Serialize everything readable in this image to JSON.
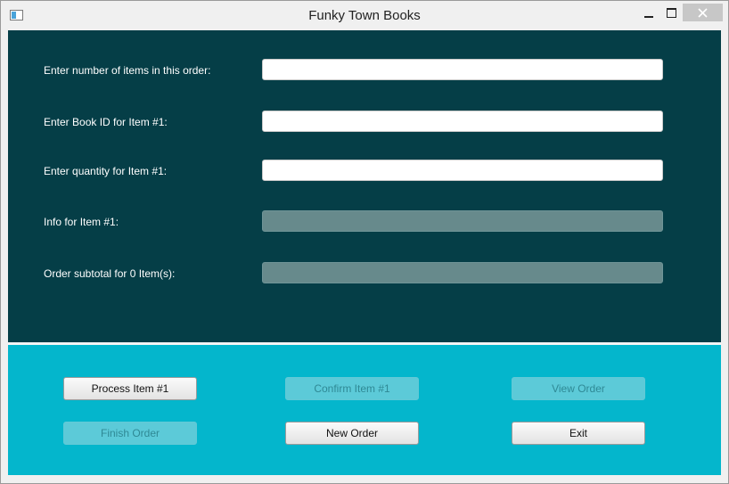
{
  "window": {
    "title": "Funky Town Books",
    "icons": [
      "app-icon",
      "minimize-icon",
      "maximize-icon",
      "close-icon"
    ]
  },
  "form": {
    "rows": [
      {
        "label": "Enter number of items in this order:",
        "value": "",
        "enabled": true
      },
      {
        "label": "Enter Book ID for Item #1:",
        "value": "",
        "enabled": true
      },
      {
        "label": "Enter quantity for Item #1:",
        "value": "",
        "enabled": true
      },
      {
        "label": "Info for Item #1:",
        "value": "",
        "enabled": false
      },
      {
        "label": "Order subtotal for 0 Item(s):",
        "value": "",
        "enabled": false
      }
    ]
  },
  "buttons": {
    "process": {
      "label": "Process Item #1",
      "enabled": true
    },
    "confirm": {
      "label": "Confirm Item #1",
      "enabled": false
    },
    "view": {
      "label": "View Order",
      "enabled": false
    },
    "finish": {
      "label": "Finish Order",
      "enabled": false
    },
    "new_order": {
      "label": "New Order",
      "enabled": true
    },
    "exit": {
      "label": "Exit",
      "enabled": true
    }
  },
  "colors": {
    "top_panel": "#053e47",
    "bottom_panel": "#04b6cc",
    "disabled_field": "#678a8c",
    "disabled_button": "#5ccad8"
  }
}
